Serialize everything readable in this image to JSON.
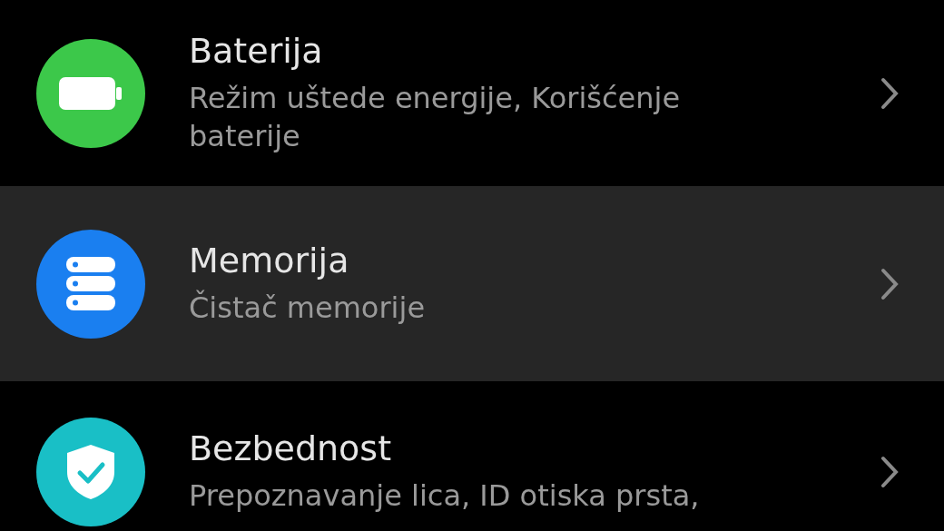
{
  "items": [
    {
      "title": "Baterija",
      "subtitle": "Režim uštede energije, Korišćenje baterije",
      "kind": "battery",
      "color": "#3cc84a",
      "selected": false
    },
    {
      "title": "Memorija",
      "subtitle": "Čistač memorije",
      "kind": "storage",
      "color": "#1a7ff0",
      "selected": true
    },
    {
      "title": "Bezbednost",
      "subtitle": "Prepoznavanje lica, ID otiska prsta,",
      "kind": "shield",
      "color": "#19bfc6",
      "selected": false
    }
  ]
}
